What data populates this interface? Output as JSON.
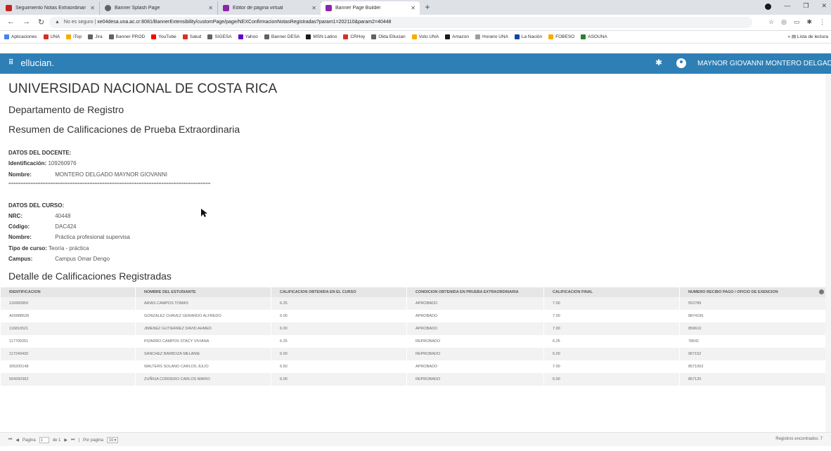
{
  "browser": {
    "tabs": [
      {
        "label": "Seguimiento Notas Extraordinari",
        "color": "#c5221f",
        "active": false
      },
      {
        "label": "Banner Splash Page",
        "color": "#5f6368",
        "active": false
      },
      {
        "label": "Editor de página virtual",
        "color": "#8e24aa",
        "active": false
      },
      {
        "label": "Banner Page Builder",
        "color": "#8e24aa",
        "active": true
      }
    ],
    "new_tab": "+",
    "security_label": "No es seguro",
    "url": "xe04desa.una.ac.cr:8081/BannerExtensibility/customPage/page/NEXConfirmacionNotasRegistradas?param1=202110&param2=40448",
    "bookmarks": [
      {
        "label": "Aplicaciones",
        "color": "#4285f4"
      },
      {
        "label": "UNA",
        "color": "#d93025"
      },
      {
        "label": "iTop",
        "color": "#f9ab00"
      },
      {
        "label": "Jira",
        "color": "#5f6368"
      },
      {
        "label": "Banner PROD",
        "color": "#5f6368"
      },
      {
        "label": "YouTube",
        "color": "#ff0000"
      },
      {
        "label": "Salud",
        "color": "#d93025"
      },
      {
        "label": "SIGESA",
        "color": "#5f6368"
      },
      {
        "label": "Yahoo",
        "color": "#6001d2"
      },
      {
        "label": "Banner DESA",
        "color": "#5f6368"
      },
      {
        "label": "MSN Latino",
        "color": "#1a1a1a"
      },
      {
        "label": "CRHoy",
        "color": "#d93025"
      },
      {
        "label": "Okta Ellucian",
        "color": "#5f6368"
      },
      {
        "label": "Voto UNA",
        "color": "#f9ab00"
      },
      {
        "label": "Amazon",
        "color": "#1a1a1a"
      },
      {
        "label": "Horario UNA",
        "color": "#9e9e9e"
      },
      {
        "label": "La Nación",
        "color": "#0d47a1"
      },
      {
        "label": "FOBESO",
        "color": "#f9ab00"
      },
      {
        "label": "ASOUNA",
        "color": "#2e7d32"
      }
    ],
    "reading_list": "Lista de lectura",
    "more_bookmarks": "»"
  },
  "header": {
    "brand": "ellucian.",
    "user_name": "MAYNOR GIOVANNI MONTERO DELGADO",
    "accent_color": "#2d7fb5"
  },
  "page": {
    "university": "UNIVERSIDAD NACIONAL DE COSTA RICA",
    "department": "Departamento de Registro",
    "summary_title": "Resumen de Calificaciones de Prueba Extraordinaria",
    "teacher_section": "DATOS DEL DOCENTE:",
    "teacher": {
      "id_label": "Identificación:",
      "id_value": "109260976",
      "name_label": "Nombre:",
      "name_value": "MONTERO DELGADO MAYNOR GIOVANNI"
    },
    "separator": "==================================================================================",
    "course_section": "DATOS DEL CURSO:",
    "course": {
      "nrc_label": "NRC:",
      "nrc_value": "40448",
      "code_label": "Código:",
      "code_value": "DAC424",
      "name_label": "Nombre:",
      "name_value": "Práctica profesional supervisa",
      "type_label": "Tipo de curso:",
      "type_value": "Teoría - práctica",
      "campus_label": "Campus:",
      "campus_value": "Campus Omar Dengo"
    },
    "detail_title": "Detalle de Calificaciones Registradas"
  },
  "grid": {
    "columns": [
      "IDENTIFICACION",
      "NOMBRE DEL ESTUDIANTE",
      "CALIFICACION OBTENIDA EN EL CURSO",
      "CONDICION OBTENIDA EN PRUEBA EXTRAORDINARIA",
      "CALIFICACION FINAL",
      "NUMERO RECIBO PAGO / OFICIO DE EXENCION"
    ],
    "rows": [
      [
        "116960950",
        "ARIAS CAMPOS TOMAS",
        "6.25",
        "APROBADO",
        "7.00",
        "552789"
      ],
      [
        "A00088528",
        "GONZALEZ CHAVEZ GERARDO ALFREDO",
        "6.00",
        "APROBADO",
        "7.00",
        "8874196"
      ],
      [
        "116810521",
        "JIMENEZ GUTIERREZ DAVID AHMED",
        "6.00",
        "APROBADO",
        "7.00",
        "859610"
      ],
      [
        "117700251",
        "PIZARRO CAMPOS STACY VIVIANA",
        "6.25",
        "REPROBADO",
        "6.25",
        "78541"
      ],
      [
        "117240430",
        "SANCHEZ BARBOZA MELANIE",
        "6.00",
        "REPROBADO",
        "6.00",
        "967152"
      ],
      [
        "305200148",
        "WALTERS SOLANO CARLOS JULIO",
        "6.50",
        "APROBADO",
        "7.00",
        "8571002"
      ],
      [
        "504260362",
        "ZUÑIGA CORDERO CARLOS MARIO",
        "6.00",
        "REPROBADO",
        "6.00",
        "857120"
      ]
    ]
  },
  "pager": {
    "first": "⏮",
    "prev": "◀",
    "page_label": "Pagina",
    "page_value": "1",
    "of_label": "de 1",
    "next": "▶",
    "last": "⏭",
    "per_page_label": "Por pagina",
    "per_page_value": "10",
    "records_label": "Registros encontrados: 7"
  }
}
